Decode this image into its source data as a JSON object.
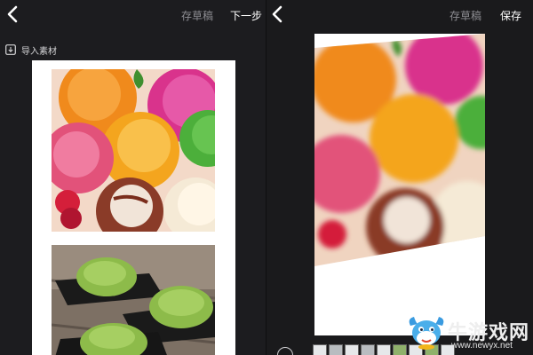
{
  "left_editor": {
    "back_icon": "chevron-left-icon",
    "draft_label": "存草稿",
    "next_label": "下一步",
    "import_icon": "import-download-icon",
    "import_label": "导入素材",
    "photos": [
      {
        "subject": "colorful-ice-cream-scoops"
      },
      {
        "subject": "green-tea-ice-cream-bowls"
      }
    ]
  },
  "right_editor": {
    "back_icon": "chevron-left-icon",
    "draft_label": "存草稿",
    "save_label": "保存",
    "photo": {
      "subject": "colorful-ice-cream-scoops-blurred"
    }
  },
  "watermark": {
    "brand": "牛游戏网",
    "url": "www.newyx.net"
  },
  "colors": {
    "background": "#1c1c1f",
    "canvas": "#ffffff",
    "muted_text": "#8e8e93",
    "primary_text": "#ffffff"
  }
}
